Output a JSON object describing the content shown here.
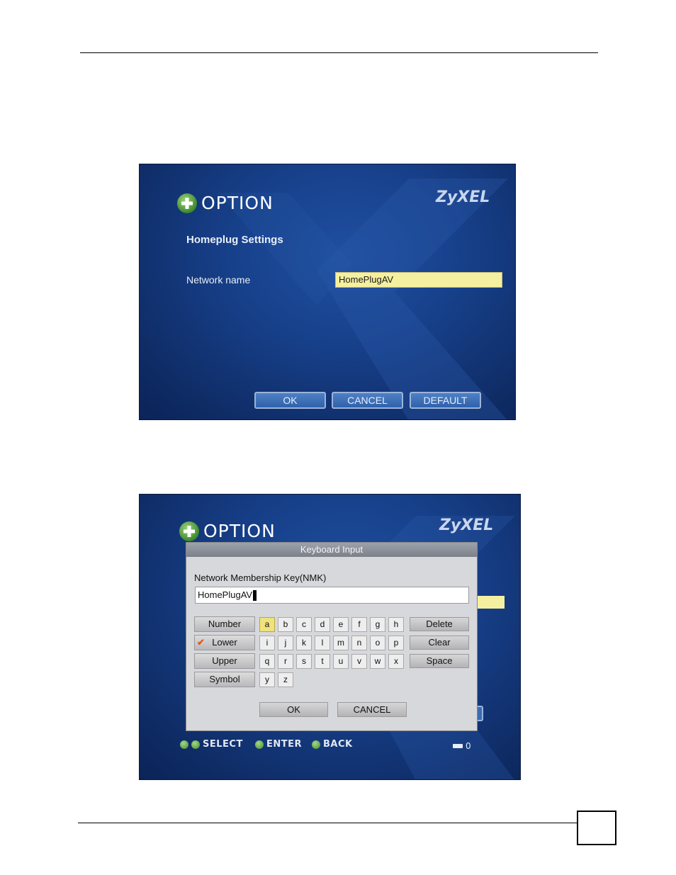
{
  "screen1": {
    "title": "OPTION",
    "brand": "ZyXEL",
    "section_title": "Homeplug Settings",
    "field_label": "Network name",
    "field_value": "HomePlugAV",
    "buttons": {
      "ok": "OK",
      "cancel": "CANCEL",
      "default": "DEFAULT"
    }
  },
  "screen2": {
    "title": "OPTION",
    "brand": "ZyXEL",
    "dialog": {
      "title": "Keyboard Input",
      "label": "Network Membership Key(NMK)",
      "input_value": "HomePlugAV",
      "modes": [
        "Number",
        "Lower",
        "Upper",
        "Symbol"
      ],
      "active_mode": "Lower",
      "keys_row1": [
        "a",
        "b",
        "c",
        "d",
        "e",
        "f",
        "g",
        "h"
      ],
      "keys_row2": [
        "i",
        "j",
        "k",
        "l",
        "m",
        "n",
        "o",
        "p"
      ],
      "keys_row3": [
        "q",
        "r",
        "s",
        "t",
        "u",
        "v",
        "w",
        "x"
      ],
      "keys_row4": [
        "y",
        "z"
      ],
      "selected_key": "a",
      "actions": {
        "delete": "Delete",
        "clear": "Clear",
        "space": "Space"
      },
      "ok": "OK",
      "cancel": "CANCEL"
    },
    "hints": {
      "select": "SELECT",
      "enter": "ENTER",
      "back": "BACK"
    },
    "counter": "0"
  },
  "colors": {
    "screen_bg": "#17408a",
    "field_bg": "#f4f0a0",
    "selected_key": "#f0e27c",
    "check_mark": "#e05a1c"
  }
}
